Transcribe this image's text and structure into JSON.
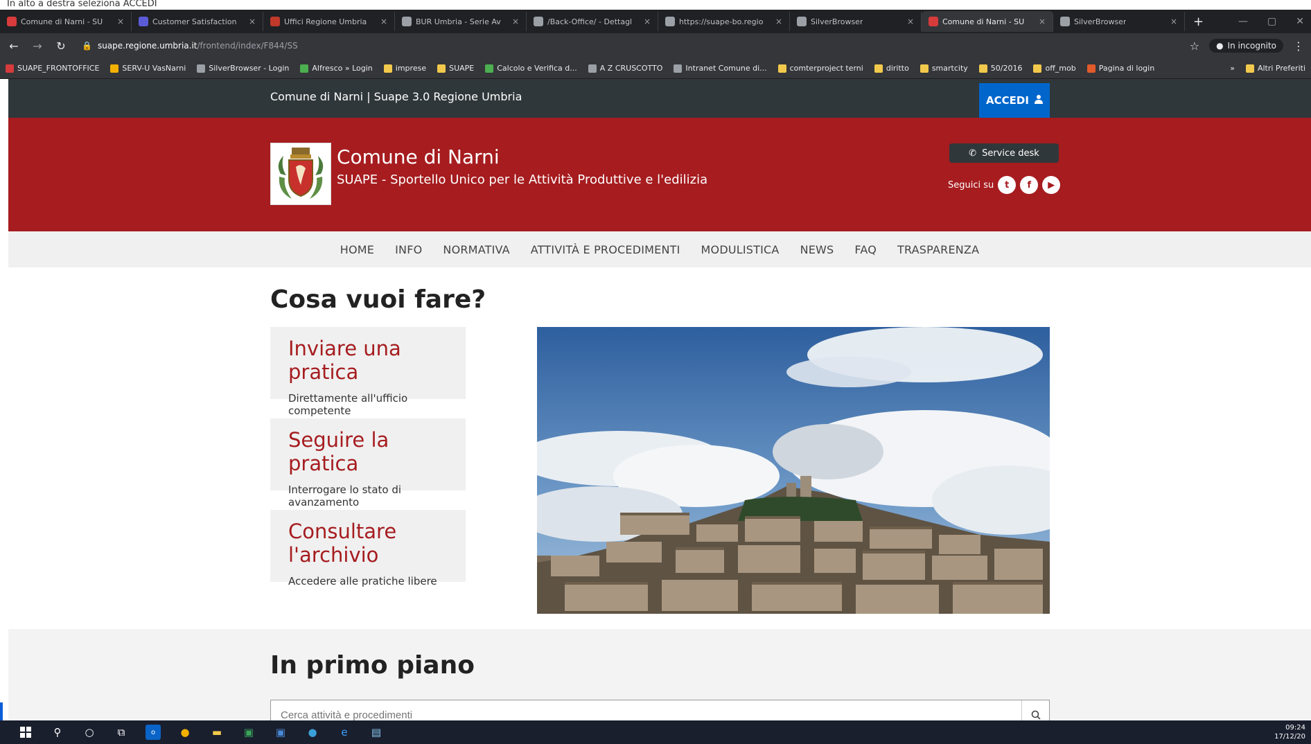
{
  "caption": "In alto a destra seleziona ACCEDI",
  "tabs": [
    {
      "label": "Comune di Narni - SU",
      "fav": "#d83b3b"
    },
    {
      "label": "Customer Satisfaction",
      "fav": "#5b5bd6"
    },
    {
      "label": "Uffici Regione Umbria",
      "fav": "#c0392b"
    },
    {
      "label": "BUR Umbria - Serie Av",
      "fav": "#9aa0a6"
    },
    {
      "label": "/Back-Office/ - Dettagl",
      "fav": "#9aa0a6"
    },
    {
      "label": "https://suape-bo.regio",
      "fav": "#9aa0a6"
    },
    {
      "label": "SilverBrowser",
      "fav": "#9aa0a6"
    },
    {
      "label": "Comune di Narni - SU",
      "fav": "#d83b3b",
      "active": true
    },
    {
      "label": "SilverBrowser",
      "fav": "#9aa0a6"
    }
  ],
  "newtab": "+",
  "address": {
    "host": "suape.regione.umbria.it",
    "path": "/frontend/index/F844/SS",
    "incognito": "In incognito"
  },
  "bookmarks": [
    {
      "label": "SUAPE_FRONTOFFICE",
      "color": "#d83b3b"
    },
    {
      "label": "SERV-U VasNarni",
      "color": "#f2b100"
    },
    {
      "label": "SilverBrowser - Login",
      "color": "#9aa0a6"
    },
    {
      "label": "Alfresco » Login",
      "color": "#4caf50"
    },
    {
      "label": "imprese",
      "color": "#f2c94c"
    },
    {
      "label": "SUAPE",
      "color": "#f2c94c"
    },
    {
      "label": "Calcolo e Verifica d...",
      "color": "#4caf50"
    },
    {
      "label": "A Z CRUSCOTTO",
      "color": "#9aa0a6"
    },
    {
      "label": "Intranet Comune di...",
      "color": "#9aa0a6"
    },
    {
      "label": "comterproject terni",
      "color": "#f2c94c"
    },
    {
      "label": "diritto",
      "color": "#f2c94c"
    },
    {
      "label": "smartcity",
      "color": "#f2c94c"
    },
    {
      "label": "50/2016",
      "color": "#f2c94c"
    },
    {
      "label": "off_mob",
      "color": "#f2c94c"
    },
    {
      "label": "Pagina di login",
      "color": "#e05a2b"
    },
    {
      "label": "»",
      "color": ""
    },
    {
      "label": "Altri Preferiti",
      "color": "#f2c94c"
    }
  ],
  "site": {
    "brand": "Comune di Narni  |  Suape 3.0 Regione Umbria",
    "accedi": "ACCEDI",
    "title": "Comune di Narni",
    "subtitle": "SUAPE - Sportello Unico per le Attività Produttive e l'edilizia",
    "service_desk": "Service desk",
    "seguici": "Seguici su",
    "menu": [
      "HOME",
      "INFO",
      "NORMATIVA",
      "ATTIVITÀ E PROCEDIMENTI",
      "MODULISTICA",
      "NEWS",
      "FAQ",
      "TRASPARENZA"
    ],
    "cosa_title": "Cosa vuoi fare?",
    "cards": [
      {
        "title": "Inviare una pratica",
        "sub": "Direttamente all'ufficio competente"
      },
      {
        "title": "Seguire la pratica",
        "sub": "Interrogare lo stato di avanzamento"
      },
      {
        "title": "Consultare l'archivio",
        "sub": "Accedere alle pratiche libere"
      }
    ],
    "primo_title": "In primo piano",
    "search_placeholder": "Cerca attività e procedimenti"
  },
  "clock": {
    "time": "09:24",
    "date": "17/12/20"
  }
}
